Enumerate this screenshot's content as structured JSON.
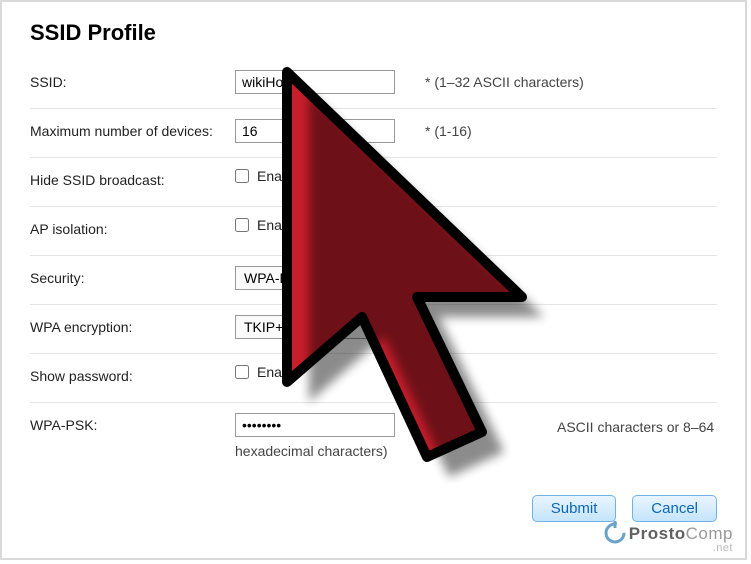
{
  "title": "SSID Profile",
  "rows": {
    "ssid": {
      "label": "SSID:",
      "value": "wikiHow",
      "hint": "*  (1–32 ASCII characters)"
    },
    "maxDevices": {
      "label": "Maximum number of devices:",
      "value": "16",
      "hint": "*   (1-16)"
    },
    "hideSsid": {
      "label": "Hide SSID broadcast:",
      "checkLabel": "Enable"
    },
    "apIsolation": {
      "label": "AP isolation:",
      "checkLabel": "Enable"
    },
    "security": {
      "label": "Security:",
      "value": "WPA-PSK &"
    },
    "wpaEncryption": {
      "label": "WPA encryption:",
      "value": "TKIP+AES"
    },
    "showPassword": {
      "label": "Show password:",
      "checkLabel": "Enable"
    },
    "wpaPsk": {
      "label": "WPA-PSK:",
      "value": "••••••••",
      "hintTail": "ASCII characters or 8–64",
      "hintBelow": "hexadecimal characters)"
    }
  },
  "buttons": {
    "submit": "Submit",
    "cancel": "Cancel"
  },
  "logo": {
    "brand1": "Prosto",
    "brand2": "Comp",
    "suffix": ".net"
  }
}
